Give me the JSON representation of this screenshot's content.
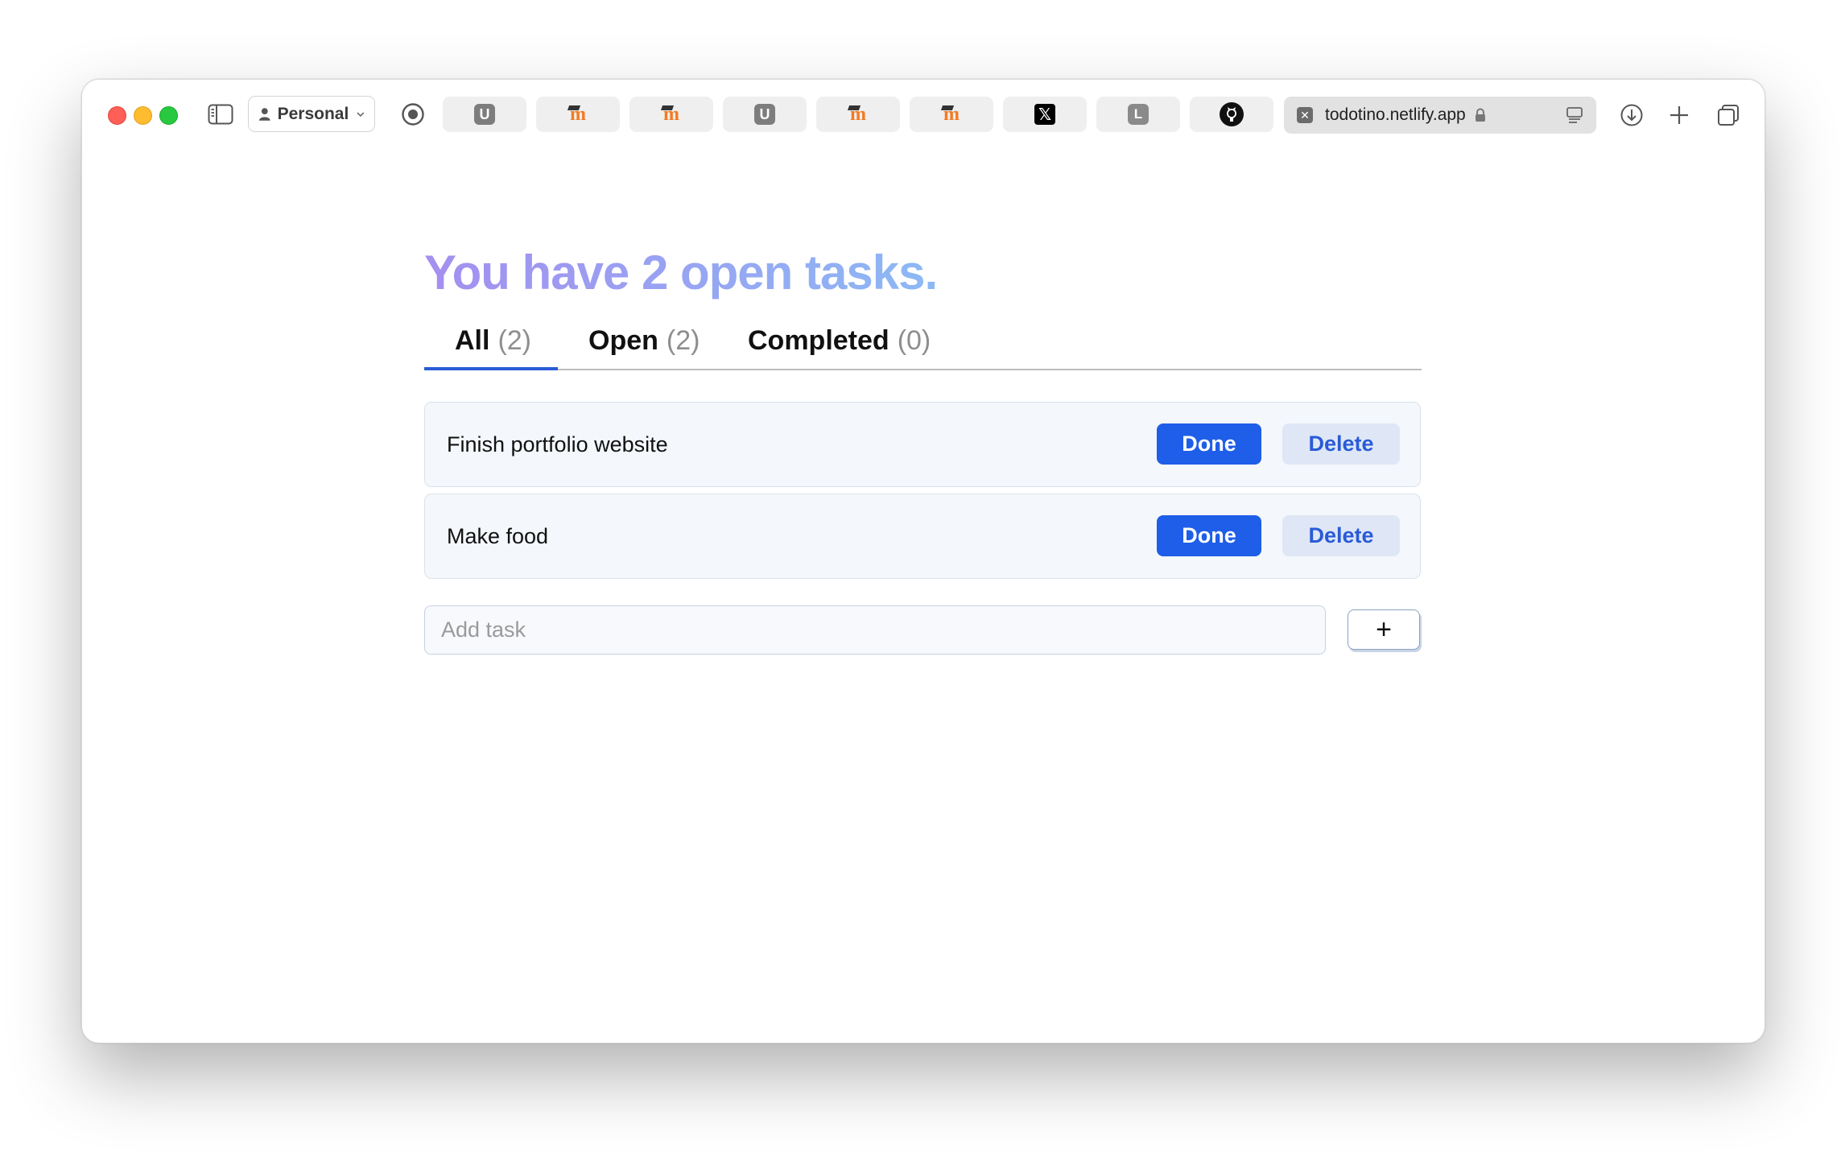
{
  "browser": {
    "profile_label": "Personal",
    "tabs": [
      {
        "icon": "u-favicon",
        "glyph": "U"
      },
      {
        "icon": "moodle-favicon",
        "glyph": "m"
      },
      {
        "icon": "moodle-favicon",
        "glyph": "m"
      },
      {
        "icon": "u-favicon",
        "glyph": "U"
      },
      {
        "icon": "moodle-favicon",
        "glyph": "m"
      },
      {
        "icon": "moodle-favicon",
        "glyph": "m"
      },
      {
        "icon": "x-favicon",
        "glyph": "𝕏"
      },
      {
        "icon": "l-favicon",
        "glyph": "L"
      },
      {
        "icon": "github-favicon",
        "glyph": ""
      }
    ],
    "active_tab": {
      "url": "todotino.netlify.app",
      "close_glyph": "✕"
    }
  },
  "app": {
    "heading": "You have 2 open tasks.",
    "filters": [
      {
        "label": "All",
        "count": "(2)",
        "active": true
      },
      {
        "label": "Open",
        "count": "(2)",
        "active": false
      },
      {
        "label": "Completed",
        "count": "(0)",
        "active": false
      }
    ],
    "tasks": [
      {
        "title": "Finish portfolio website",
        "done_label": "Done",
        "delete_label": "Delete"
      },
      {
        "title": "Make food",
        "done_label": "Done",
        "delete_label": "Delete"
      }
    ],
    "add_input": {
      "placeholder": "Add task",
      "value": ""
    },
    "add_button_label": "+"
  },
  "colors": {
    "accent": "#1e5ee8",
    "heading_gradient_start": "#a48ff0",
    "heading_gradient_end": "#8cb9f4"
  }
}
